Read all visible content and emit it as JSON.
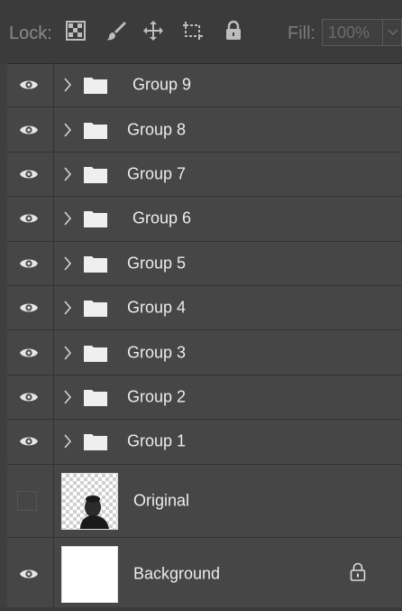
{
  "lock_bar": {
    "label": "Lock:",
    "fill_label": "Fill:",
    "fill_value": "100%",
    "icons": [
      "lock-transparent-pixels-icon",
      "lock-image-pixels-icon",
      "lock-position-icon",
      "prevent-auto-nesting-icon",
      "lock-all-icon"
    ]
  },
  "layers": [
    {
      "name": "Group 9",
      "type": "group",
      "visible": true
    },
    {
      "name": "Group 8",
      "type": "group",
      "visible": true
    },
    {
      "name": "Group 7",
      "type": "group",
      "visible": true
    },
    {
      "name": "Group 6",
      "type": "group",
      "visible": true
    },
    {
      "name": "Group 5",
      "type": "group",
      "visible": true
    },
    {
      "name": "Group 4",
      "type": "group",
      "visible": true
    },
    {
      "name": "Group 3",
      "type": "group",
      "visible": true
    },
    {
      "name": "Group 2",
      "type": "group",
      "visible": true
    },
    {
      "name": "Group 1",
      "type": "group",
      "visible": true
    },
    {
      "name": "Original",
      "type": "pixel",
      "visible": false
    },
    {
      "name": "Background",
      "type": "background",
      "visible": true,
      "locked": true
    }
  ],
  "colors": {
    "panel_bg": "#464646",
    "row_divider": "#333333",
    "text": "#ececec",
    "muted": "#8b8b8b"
  }
}
